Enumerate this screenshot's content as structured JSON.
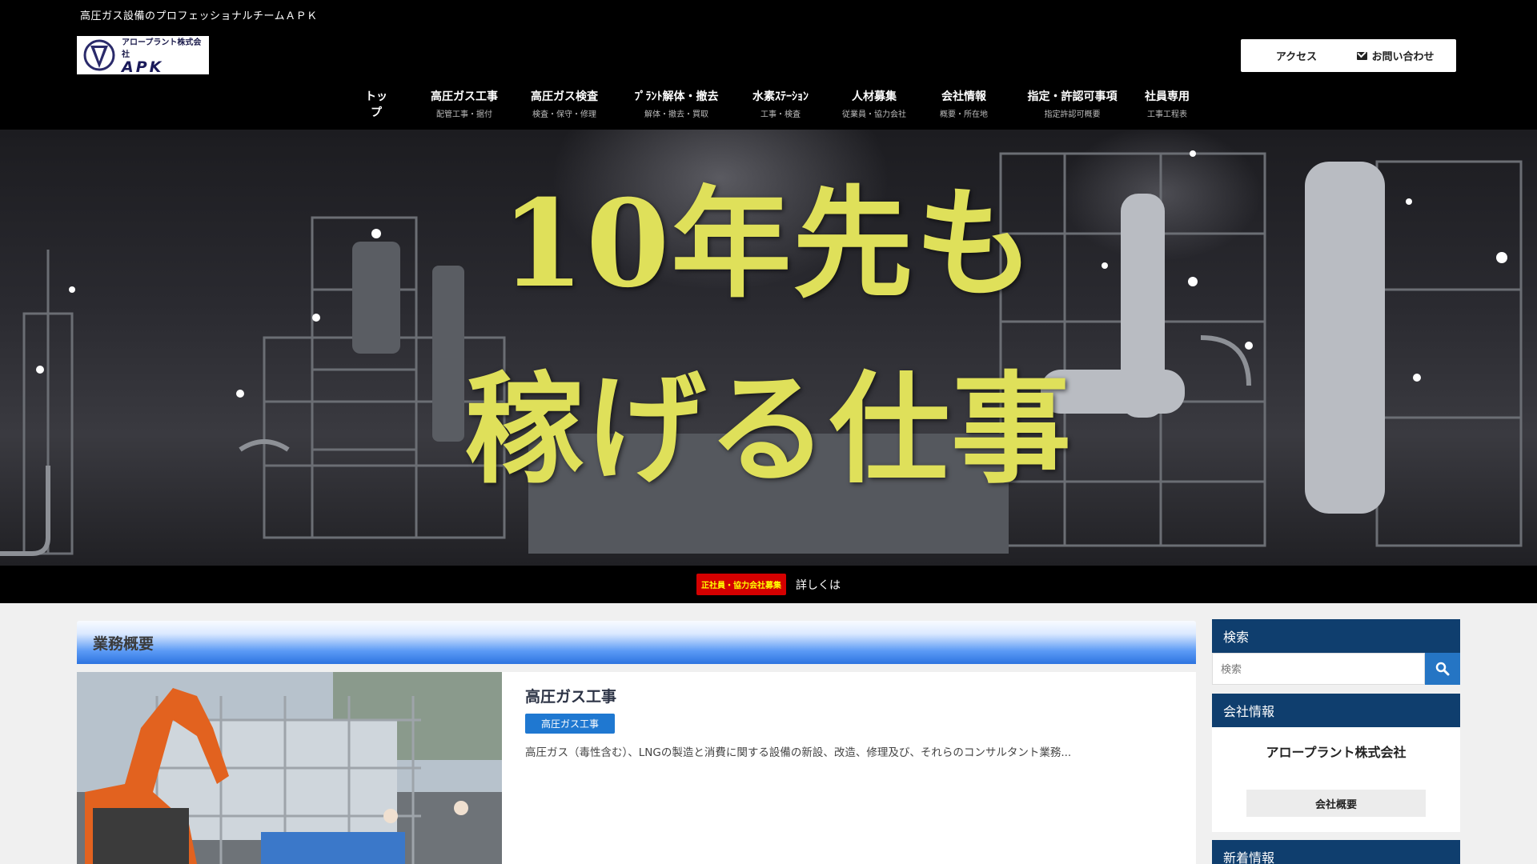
{
  "header": {
    "tagline": "高圧ガス設備のプロフェッショナルチームＡＰＫ",
    "logo_small": "アロープラント株式会社",
    "logo_big": "APK",
    "access_label": "アクセス",
    "contact_label": "お問い合わせ"
  },
  "nav": {
    "items": [
      {
        "main": "トップ",
        "sub": ""
      },
      {
        "main": "高圧ガス工事",
        "sub": "配管工事・据付"
      },
      {
        "main": "高圧ガス検査",
        "sub": "検査・保守・修理"
      },
      {
        "main": "ﾌﾟﾗﾝﾄ解体・撤去",
        "sub": "解体・撤去・買取"
      },
      {
        "main": "水素ｽﾃｰｼｮﾝ",
        "sub": "工事・検査"
      },
      {
        "main": "人材募集",
        "sub": "従業員・協力会社"
      },
      {
        "main": "会社情報",
        "sub": "概要・所在地"
      },
      {
        "main": "指定・許認可事項",
        "sub": "指定許認可概要"
      },
      {
        "main": "社員専用",
        "sub": "工事工程表"
      }
    ]
  },
  "hero": {
    "line1": "10年先も",
    "line2": "稼げる仕事"
  },
  "recruit": {
    "badge": "正社員・協力会社募集",
    "link": "詳しくは"
  },
  "main": {
    "section_title": "業務概要",
    "card": {
      "title": "高圧ガス工事",
      "category": "高圧ガス工事",
      "description": "高圧ガス（毒性含む）、LNGの製造と消費に関する設備の新設、改造、修理及び、それらのコンサルタント業務..."
    }
  },
  "sidebar": {
    "search_title": "検索",
    "search_placeholder": "検索",
    "company_title": "会社情報",
    "company_name": "アロープラント株式会社",
    "company_button": "会社概要",
    "news_title": "新着情報"
  },
  "colors": {
    "header_bg": "#000000",
    "hero_text": "#dfe05a",
    "section_blue": "#2d74e0",
    "widget_title_bg": "#0f3e6e",
    "category_badge": "#1f78d1",
    "recruit_badge": "#d40000"
  }
}
